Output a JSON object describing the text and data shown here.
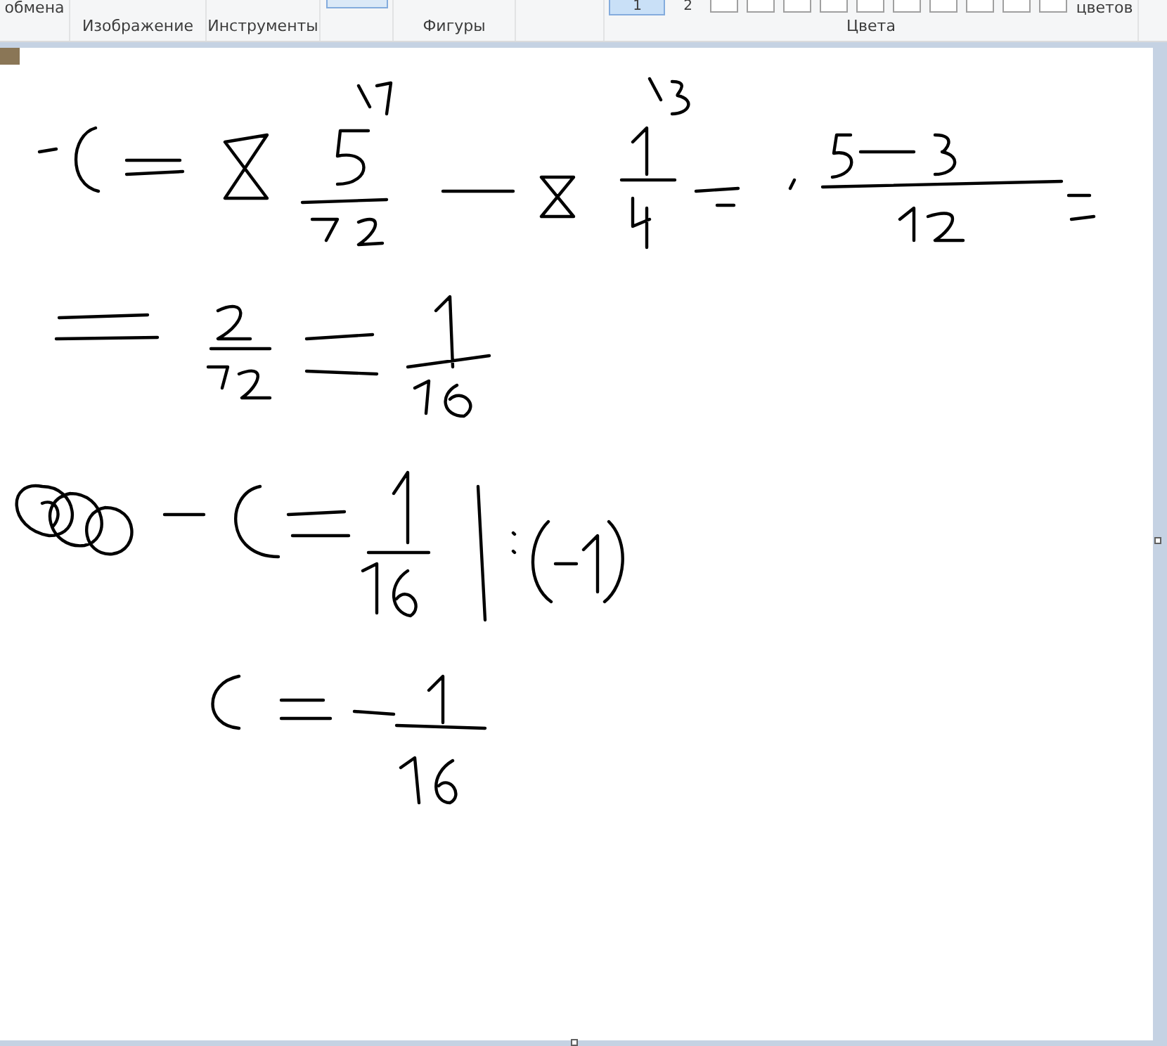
{
  "ribbon": {
    "clipped_items": [
      {
        "kind": "text",
        "label": "обмена"
      },
      {
        "kind": "color",
        "label": "1",
        "selected": true
      },
      {
        "kind": "color",
        "label": "2",
        "selected": false
      },
      {
        "kind": "text",
        "label": "цветов"
      }
    ],
    "groups": [
      "Изображение",
      "Инструменты",
      "Фигуры",
      "Цвета"
    ]
  }
}
